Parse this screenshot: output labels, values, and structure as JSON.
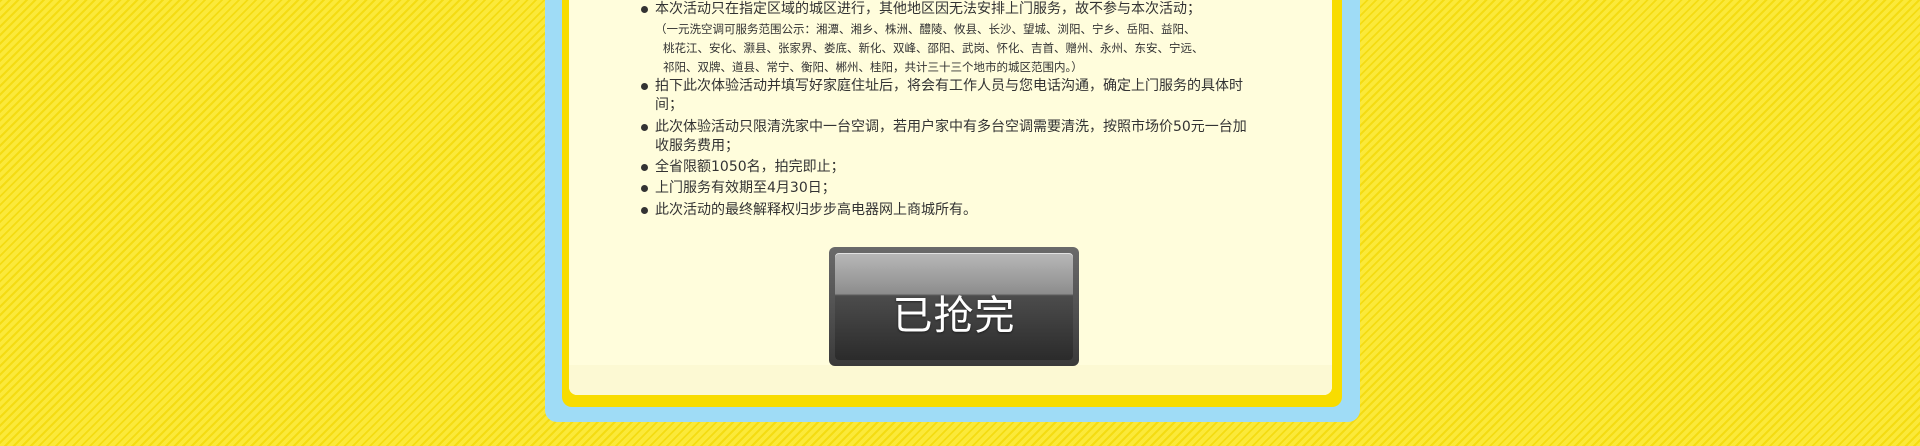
{
  "rules": [
    {
      "text": "本次活动只在指定区域的城区进行，其他地区因无法安排上门服务，故不参与本次活动；",
      "note_lines": [
        "（一元洗空调可服务范围公示：湘潭、湘乡、株洲、醴陵、攸县、长沙、望城、浏阳、宁乡、岳阳、益阳、",
        "桃花江、安化、灏县、张家界、娄底、新化、双峰、邵阳、武岗、怀化、吉首、赠州、永州、东安、宁远、",
        "祁阳、双牌、道县、常宁、衡阳、郴州、桂阳，共计三十三个地市的城区范围内。）"
      ]
    },
    {
      "text": "拍下此次体验活动并填写好家庭住址后，将会有工作人员与您电话沟通，确定上门服务的具体时间；"
    },
    {
      "text": "此次体验活动只限清洗家中一台空调，若用户家中有多台空调需要清洗，按照市场价50元一台加收服务费用；"
    },
    {
      "text": "全省限额1050名，拍完即止；"
    },
    {
      "text": "上门服务有效期至4月30日；"
    },
    {
      "text": "此次活动的最终解释权归步步高电器网上商城所有。"
    }
  ],
  "sold_out_button": {
    "label": "已抢完"
  },
  "colors": {
    "background_yellow": "#f7e11a",
    "frame_blue": "#9fdcf6",
    "frame_yellow": "#f8dc00",
    "card_cream": "#fffddc",
    "button_dark": "#3a3a3a"
  }
}
